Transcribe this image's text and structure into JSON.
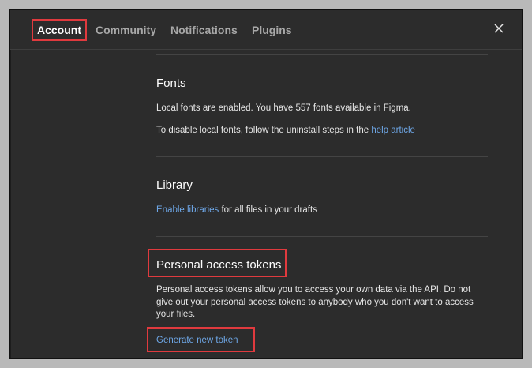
{
  "tabs": [
    {
      "label": "Account",
      "active": true
    },
    {
      "label": "Community",
      "active": false
    },
    {
      "label": "Notifications",
      "active": false
    },
    {
      "label": "Plugins",
      "active": false
    }
  ],
  "fonts": {
    "title": "Fonts",
    "line1": "Local fonts are enabled. You have 557 fonts available in Figma.",
    "line2_prefix": "To disable local fonts, follow the uninstall steps in the ",
    "line2_link": "help article"
  },
  "library": {
    "title": "Library",
    "link": "Enable libraries",
    "suffix": " for all files in your drafts"
  },
  "tokens": {
    "title": "Personal access tokens",
    "description": "Personal access tokens allow you to access your own data via the API. Do not give out your personal access tokens to anybody who you don't want to access your files.",
    "generate_label": "Generate new token"
  },
  "colors": {
    "background": "#2c2c2c",
    "link": "#6ea7e7",
    "highlight": "#e03a3e"
  }
}
